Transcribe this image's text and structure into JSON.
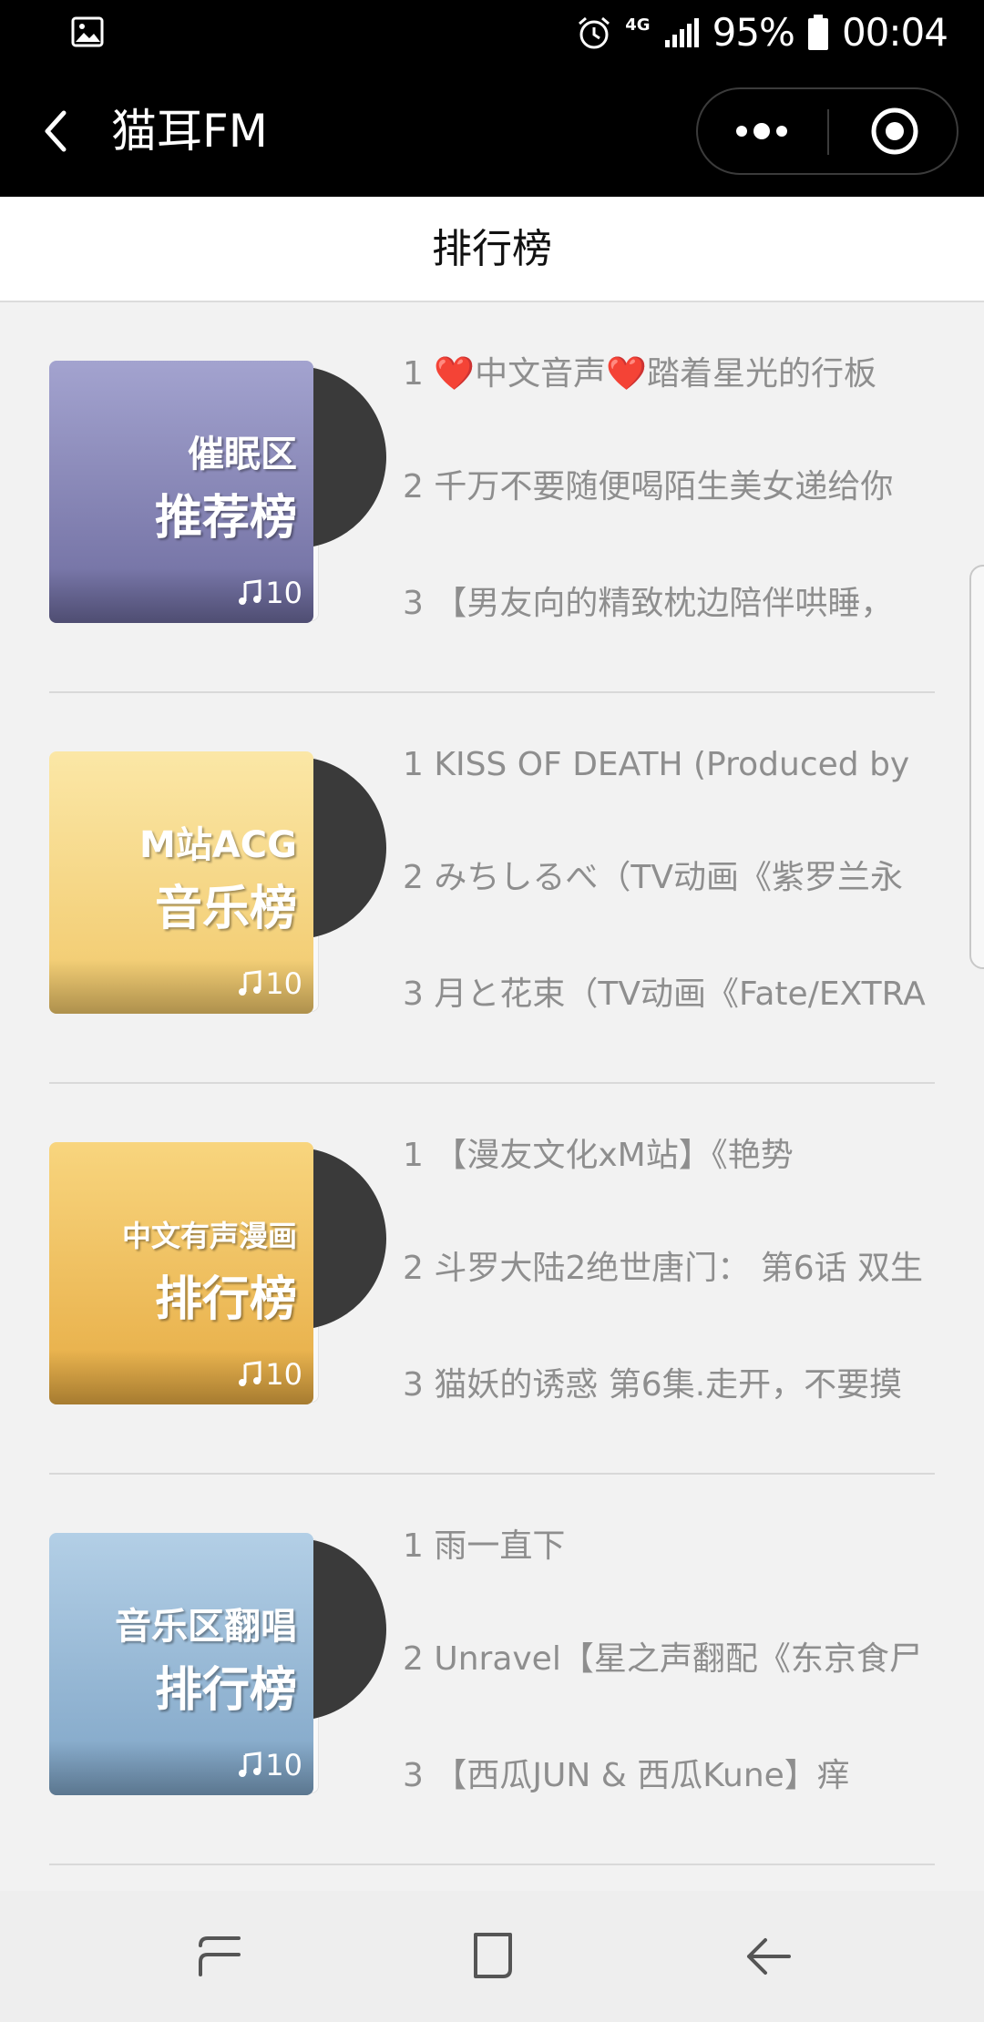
{
  "status_bar": {
    "network": "4G",
    "battery": "95%",
    "time": "00:04"
  },
  "header": {
    "title": "猫耳FM"
  },
  "page": {
    "title": "排行榜"
  },
  "rankings": [
    {
      "cover_line1": "催眠区",
      "cover_line2": "推荐榜",
      "count": "10",
      "color_top": "#a3a3cf",
      "color_bottom": "#6d6b9e",
      "tracks": [
        "1 ❤️中文音声❤️踏着星光的行板",
        "2 千万不要随便喝陌生美女递给你",
        "3 【男友向的精致枕边陪伴哄睡，"
      ]
    },
    {
      "cover_line1": "M站ACG",
      "cover_line2": "音乐榜",
      "count": "10",
      "color_top": "#fbe7a6",
      "color_bottom": "#f1c86a",
      "tracks": [
        "1 KISS OF DEATH (Produced by",
        "2 みちしるべ（TV动画《紫罗兰永",
        "3 月と花束（TV动画《Fate/EXTRA"
      ]
    },
    {
      "cover_line1": "中文有声漫画",
      "cover_line2": "排行榜",
      "count": "10",
      "color_top": "#f8d57e",
      "color_bottom": "#e6ab43",
      "tracks": [
        "1 【漫友文化xM站】《艳势",
        "2 斗罗大陆2绝世唐门： 第6话 双生",
        "3 猫妖的诱惑 第6集.走开，不要摸"
      ]
    },
    {
      "cover_line1": "音乐区翻唱",
      "cover_line2": "排行榜",
      "count": "10",
      "color_top": "#b3cfe6",
      "color_bottom": "#7ea4c6",
      "tracks": [
        "1 雨一直下",
        "2 Unravel【星之声翻配《东京食尸",
        "3 【西瓜JUN & 西瓜Kune】痒"
      ]
    }
  ]
}
